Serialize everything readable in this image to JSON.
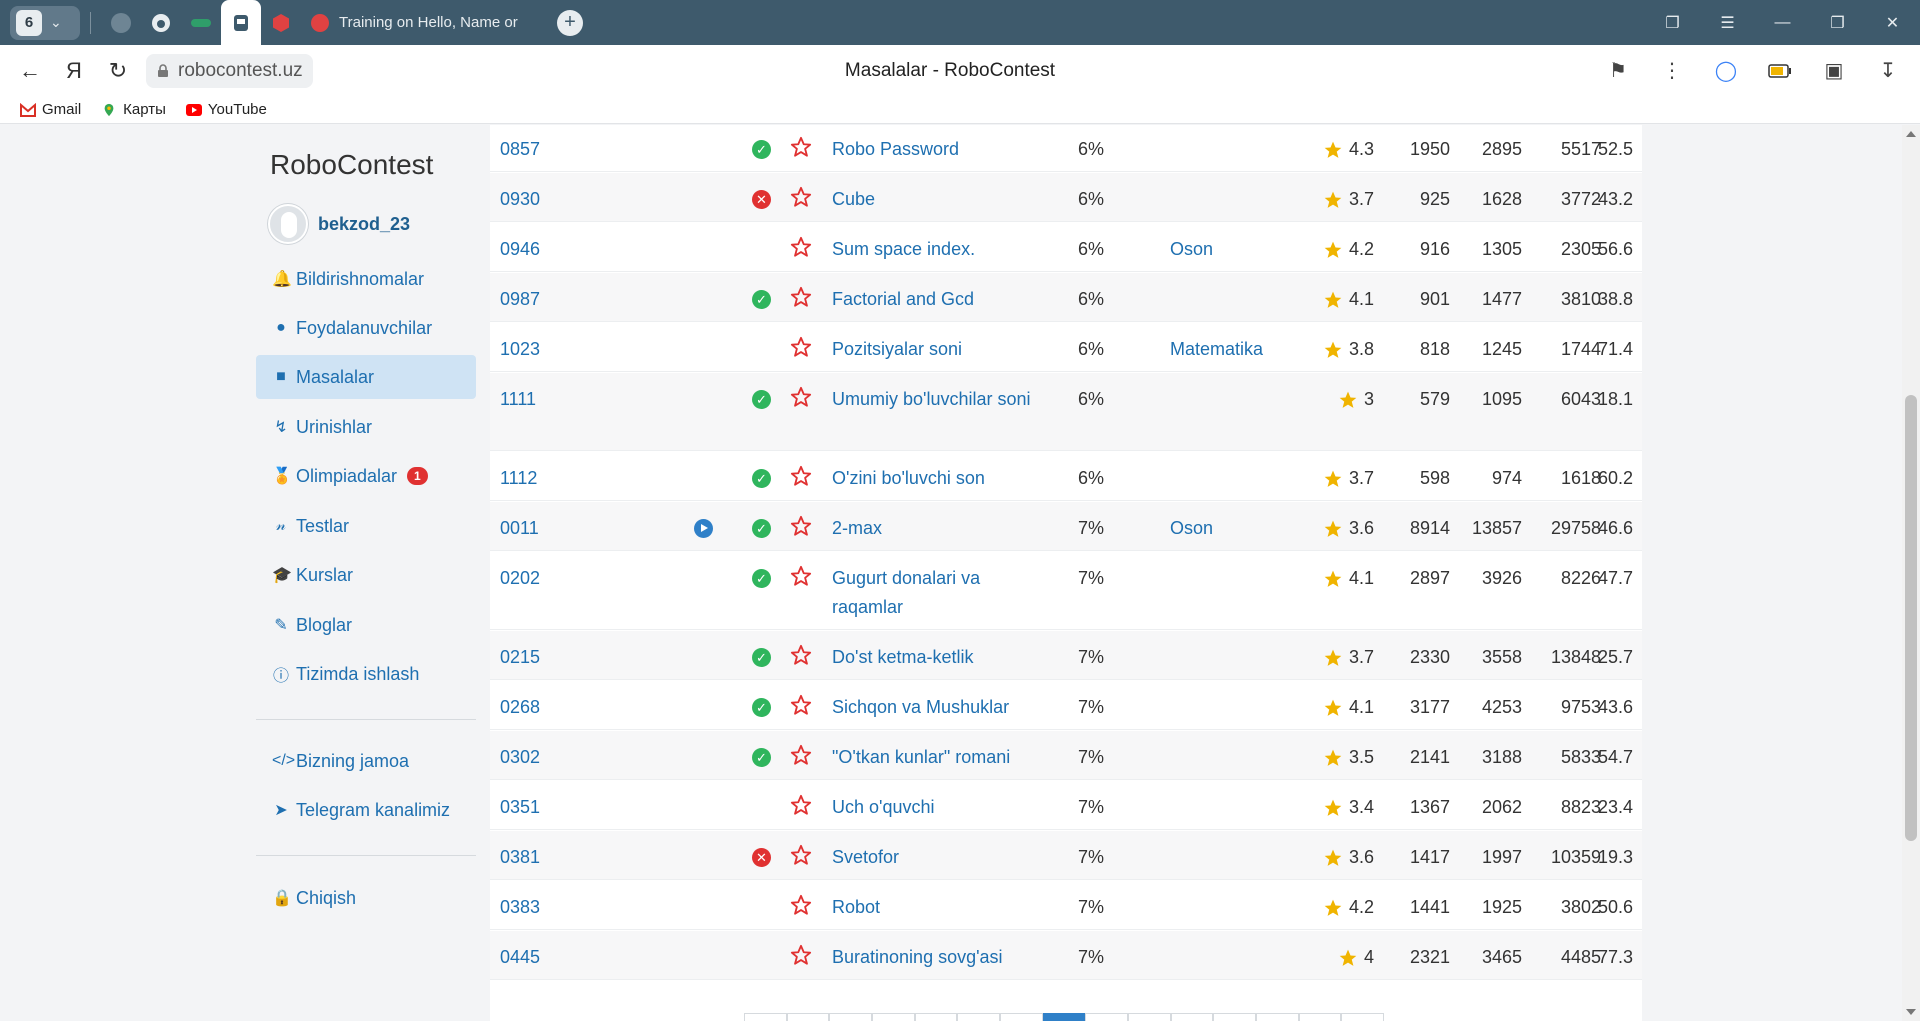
{
  "browser": {
    "tab_count": "6",
    "active_tab_title": "Training on Hello, Name or",
    "url": "robocontest.uz",
    "page_title": "Masalalar - RoboContest",
    "bookmarks": [
      "Gmail",
      "Карты",
      "YouTube"
    ],
    "accent": "#3e5a6c"
  },
  "sidebar": {
    "brand": "RoboContest",
    "username": "bekzod_23",
    "items": [
      {
        "label": "Bildirishnomalar",
        "icon": "bell-icon"
      },
      {
        "label": "Foydalanuvchilar",
        "icon": "user-icon"
      },
      {
        "label": "Masalalar",
        "icon": "book-icon",
        "active": true
      },
      {
        "label": "Urinishlar",
        "icon": "bolt-icon"
      },
      {
        "label": "Olimpiadalar",
        "icon": "medal-icon",
        "badge": "1"
      },
      {
        "label": "Testlar",
        "icon": "x-squared-icon"
      },
      {
        "label": "Kurslar",
        "icon": "graduation-cap-icon"
      },
      {
        "label": "Bloglar",
        "icon": "pencil-icon"
      },
      {
        "label": "Tizimda ishlash",
        "icon": "info-icon"
      }
    ],
    "links": [
      {
        "label": "Bizning jamoa",
        "icon": "code-icon"
      },
      {
        "label": "Telegram kanalimiz",
        "icon": "telegram-icon"
      }
    ],
    "logout": "Chiqish"
  },
  "problems": [
    {
      "id": "0857",
      "status": "solved",
      "video": false,
      "name": "Robo Password",
      "pct": "6%",
      "tag": "",
      "rating": "4.3",
      "n1": "1950",
      "n2": "2895",
      "n3": "5517",
      "n4": "52.5"
    },
    {
      "id": "0930",
      "status": "failed",
      "video": false,
      "name": "Cube",
      "pct": "6%",
      "tag": "",
      "rating": "3.7",
      "n1": "925",
      "n2": "1628",
      "n3": "3772",
      "n4": "43.2"
    },
    {
      "id": "0946",
      "status": "",
      "video": false,
      "name": "Sum space index.",
      "pct": "6%",
      "tag": "Oson",
      "rating": "4.2",
      "n1": "916",
      "n2": "1305",
      "n3": "2305",
      "n4": "56.6"
    },
    {
      "id": "0987",
      "status": "solved",
      "video": false,
      "name": "Factorial and Gcd",
      "pct": "6%",
      "tag": "",
      "rating": "4.1",
      "n1": "901",
      "n2": "1477",
      "n3": "3810",
      "n4": "38.8"
    },
    {
      "id": "1023",
      "status": "",
      "video": false,
      "name": "Pozitsiyalar soni",
      "pct": "6%",
      "tag": "Matematika",
      "rating": "3.8",
      "n1": "818",
      "n2": "1245",
      "n3": "1744",
      "n4": "71.4"
    },
    {
      "id": "1111",
      "status": "solved",
      "video": false,
      "name": "Umumiy bo'luvchilar soni",
      "pct": "6%",
      "tag": "",
      "rating": "3",
      "n1": "579",
      "n2": "1095",
      "n3": "6043",
      "n4": "18.1"
    },
    {
      "id": "1112",
      "status": "solved",
      "video": false,
      "name": "O'zini bo'luvchi son",
      "pct": "6%",
      "tag": "",
      "rating": "3.7",
      "n1": "598",
      "n2": "974",
      "n3": "1618",
      "n4": "60.2"
    },
    {
      "id": "0011",
      "status": "solved",
      "video": true,
      "name": "2-max",
      "pct": "7%",
      "tag": "Oson",
      "rating": "3.6",
      "n1": "8914",
      "n2": "13857",
      "n3": "29758",
      "n4": "46.6"
    },
    {
      "id": "0202",
      "status": "solved",
      "video": false,
      "name": "Gugurt donalari va raqamlar",
      "pct": "7%",
      "tag": "",
      "rating": "4.1",
      "n1": "2897",
      "n2": "3926",
      "n3": "8226",
      "n4": "47.7"
    },
    {
      "id": "0215",
      "status": "solved",
      "video": false,
      "name": "Do'st ketma-ketlik",
      "pct": "7%",
      "tag": "",
      "rating": "3.7",
      "n1": "2330",
      "n2": "3558",
      "n3": "13848",
      "n4": "25.7"
    },
    {
      "id": "0268",
      "status": "solved",
      "video": false,
      "name": "Sichqon va Mushuklar",
      "pct": "7%",
      "tag": "",
      "rating": "4.1",
      "n1": "3177",
      "n2": "4253",
      "n3": "9753",
      "n4": "43.6"
    },
    {
      "id": "0302",
      "status": "solved",
      "video": false,
      "name": "\"O'tkan kunlar\" romani",
      "pct": "7%",
      "tag": "",
      "rating": "3.5",
      "n1": "2141",
      "n2": "3188",
      "n3": "5833",
      "n4": "54.7"
    },
    {
      "id": "0351",
      "status": "",
      "video": false,
      "name": "Uch o'quvchi",
      "pct": "7%",
      "tag": "",
      "rating": "3.4",
      "n1": "1367",
      "n2": "2062",
      "n3": "8823",
      "n4": "23.4"
    },
    {
      "id": "0381",
      "status": "failed",
      "video": false,
      "name": "Svetofor",
      "pct": "7%",
      "tag": "",
      "rating": "3.6",
      "n1": "1417",
      "n2": "1997",
      "n3": "10359",
      "n4": "19.3"
    },
    {
      "id": "0383",
      "status": "",
      "video": false,
      "name": "Robot",
      "pct": "7%",
      "tag": "",
      "rating": "4.2",
      "n1": "1441",
      "n2": "1925",
      "n3": "3802",
      "n4": "50.6"
    },
    {
      "id": "0445",
      "status": "",
      "video": false,
      "name": "Buratinoning sovg'asi",
      "pct": "7%",
      "tag": "",
      "rating": "4",
      "n1": "2321",
      "n2": "3465",
      "n3": "4485",
      "n4": "77.3"
    }
  ],
  "colors": {
    "link": "#1e6fb0",
    "solved": "#2fb55d",
    "failed": "#e03131",
    "star": "#f0b400",
    "fav_star": "#e03131"
  }
}
